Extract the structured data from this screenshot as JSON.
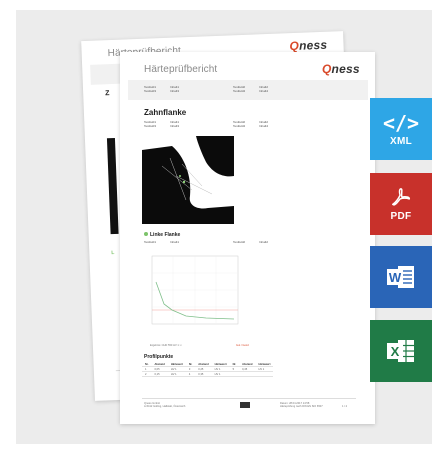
{
  "report": {
    "title": "Härteprüfbericht",
    "logo_q": "Q",
    "logo_rest": "ness",
    "meta_rows": [
      [
        "Testfeld1",
        "Inhalt1",
        "Testfeld2",
        "Inhalt2"
      ],
      [
        "Testfeld3",
        "Inhalt3",
        "Testfeld4",
        "Inhalt4"
      ]
    ],
    "section_main": "Zahnflanke",
    "section_left": "Linke Flanke",
    "chart_caption": "Ergebnis: CHD 550 HV 1: x",
    "chart_status": "Gut / Good",
    "points_title": "Profilpunkte",
    "points_header": [
      "Nr.",
      "Abstand",
      "Härtewert",
      "Nr.",
      "Abstand",
      "Härtewert",
      "Nr.",
      "Abstand",
      "Härtewert"
    ],
    "points_rows": [
      [
        "1",
        "0,05",
        "HV 1",
        "3",
        "0,25",
        "HV 1",
        "5",
        "0,45",
        "HV 1"
      ],
      [
        "2",
        "0,15",
        "HV 1",
        "4",
        "0,35",
        "HV 1",
        "",
        "",
        ""
      ]
    ],
    "footer_left": [
      "Qness GmbH",
      "A-5412 Golling, Hallstatt, Österreich"
    ],
    "footer_right": [
      "Datum: 28.04.2017 14:58",
      "Härteprüfung nach DIN EN ISO 6507"
    ],
    "page_number": "1 / 2"
  },
  "badges": {
    "xml_code": "</>",
    "xml_label": "XML",
    "pdf_label": "PDF",
    "word_letter": "W",
    "excel_letter": "X"
  },
  "colors": {
    "xml": "#2ea6e6",
    "pdf": "#c8312b",
    "word": "#2a65b7",
    "excel": "#207b47",
    "logo_accent": "#d94a2b"
  }
}
